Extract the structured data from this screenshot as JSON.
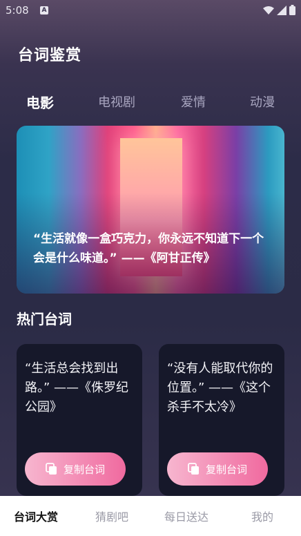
{
  "status": {
    "time": "5:08",
    "badge": "A"
  },
  "header": {
    "title": "台词鉴赏"
  },
  "tabs": [
    {
      "label": "电影",
      "active": true
    },
    {
      "label": "电视剧",
      "active": false
    },
    {
      "label": "爱情",
      "active": false
    },
    {
      "label": "动漫",
      "active": false
    }
  ],
  "banner": {
    "quote": "“生活就像一盒巧克力，你永远不知道下一个会是什么味道。” ——《阿甘正传》"
  },
  "hot": {
    "title": "热门台词",
    "cards": [
      {
        "quote": "“生活总会找到出路。” ——《侏罗纪公园》",
        "button": "复制台词"
      },
      {
        "quote": "“没有人能取代你的位置。” ——《这个杀手不太冷》",
        "button": "复制台词"
      }
    ]
  },
  "bottom_nav": [
    {
      "label": "台词大赏",
      "active": true
    },
    {
      "label": "猜剧吧",
      "active": false
    },
    {
      "label": "每日送达",
      "active": false
    },
    {
      "label": "我的",
      "active": false
    }
  ]
}
